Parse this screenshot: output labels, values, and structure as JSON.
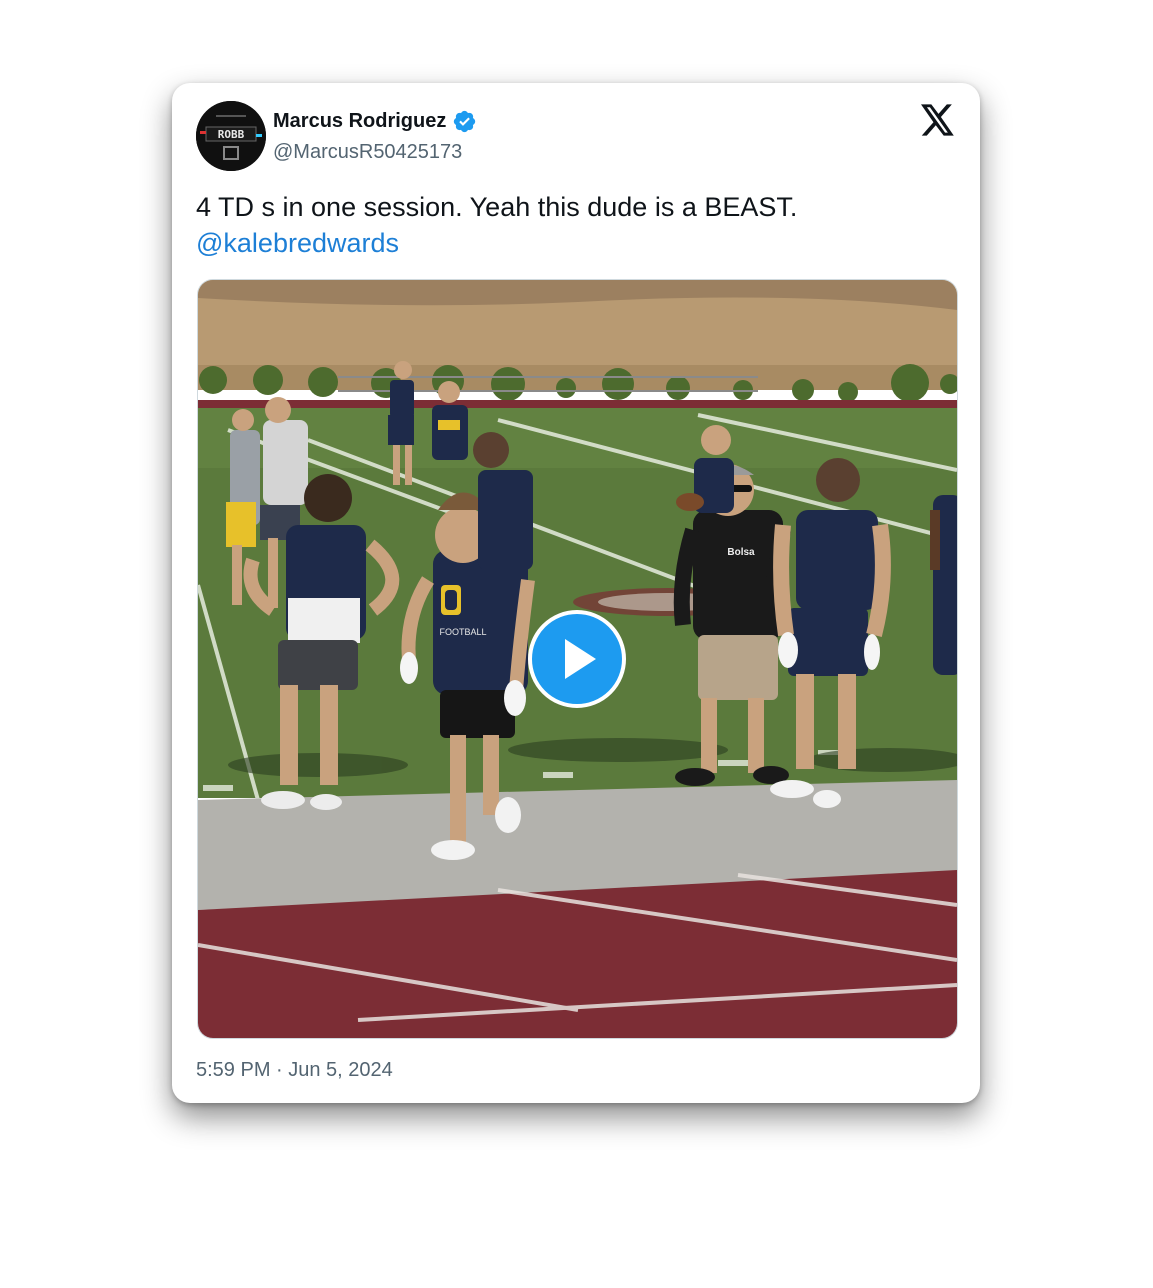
{
  "author": {
    "display_name": "Marcus Rodriguez",
    "handle": "@MarcusR50425173",
    "verified": true,
    "avatar_text": "ROBB"
  },
  "tweet": {
    "text": "4 TD s in one session. Yeah this dude is a BEAST.",
    "mention": "@kalebredwards",
    "timestamp": "5:59 PM · Jun 5, 2024"
  },
  "media": {
    "type": "video",
    "shirt_text": "FOOTBALL",
    "coach_shirt_text": "Bolsa"
  },
  "icons": {
    "brand": "x-logo-icon",
    "verified": "verified-badge-icon",
    "play": "play-icon"
  },
  "colors": {
    "link": "#1d7fd6",
    "verified": "#1d9bf0",
    "play_button": "#1d9bf0",
    "secondary_text": "#536471",
    "field_green": "#5b7a3c",
    "endzone_maroon": "#7c2d35"
  }
}
